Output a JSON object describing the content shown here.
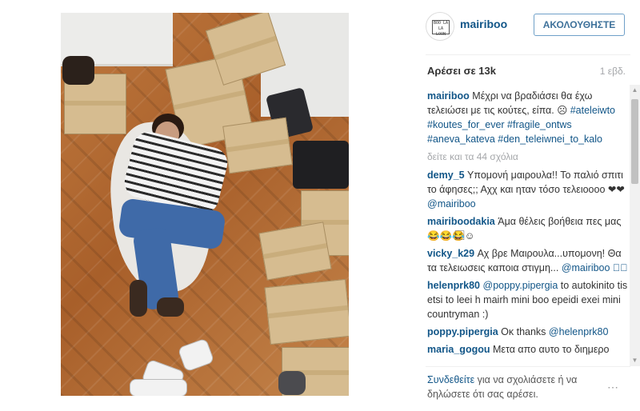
{
  "post": {
    "author": "mairiboo",
    "follow_label": "ΑΚΟΛΟΥΘΗΣΤΕ",
    "avatar_logo": "BOO LA LA LOON",
    "likes": "Αρέσει σε 13k",
    "time": "1 εβδ.",
    "caption": {
      "user": "mairiboo",
      "text": "Μέχρι να βραδιάσει θα έχω τελειώσει με τις κούτες, είπα. ☹",
      "hashtags": "#ateleiwto #koutes_for_ever #fragile_ontws #aneva_kateva #den_teleiwnei_to_kalo"
    },
    "view_more": "δείτε και τα 44 σχόλια"
  },
  "comments": [
    {
      "user": "demy_5",
      "text": "Υπομονή μαιρουλα!! Το παλιό σπιτι το άφησες;; Αχχ και ηταν τόσο τελειοοοο ❤❤",
      "mention": "@mairiboo"
    },
    {
      "user": "mairiboodakia",
      "text": "Άμα θέλεις βοήθεια πες μας 😂😂😂⃞☺",
      "mention": ""
    },
    {
      "user": "vicky_k29",
      "text": "Αχ βρε Μαιρουλα...υπομονη! Θα τα τελειωσεις καποια στιγμη...",
      "mention": "@mairiboo ⃞⃞"
    },
    {
      "user": "helenprk80",
      "mention_before": "@poppy.pipergia",
      "text": "to autokinito tis etsi to leei h mairh mini boo epeidi exei mini countryman :)"
    },
    {
      "user": "poppy.pipergia",
      "text": "Οκ thanks",
      "mention": "@helenprk80"
    },
    {
      "user": "maria_gogou",
      "text": "Μετα απο αυτο το διημερο",
      "mention": ""
    }
  ],
  "footer": {
    "login": "Συνδεθείτε",
    "rest": " για να σχολιάσετε ή να δηλώσετε ότι σας αρέσει.",
    "options": "⋯"
  },
  "scrollbar": {
    "up": "▲",
    "down": "▼"
  },
  "colors": {
    "link": "#125688",
    "follow": "#3f729b",
    "muted": "#a5a7aa"
  }
}
